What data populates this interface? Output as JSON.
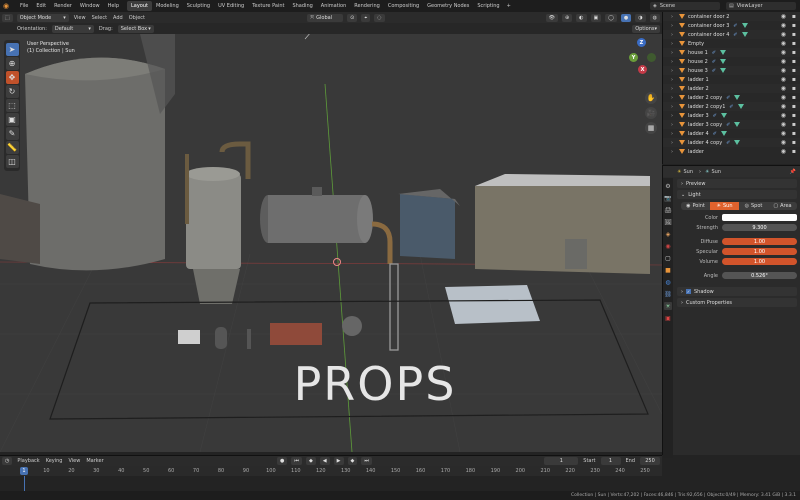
{
  "menubar": {
    "menus": [
      "File",
      "Edit",
      "Render",
      "Window",
      "Help"
    ],
    "workspaces": [
      "Layout",
      "Modeling",
      "Sculpting",
      "UV Editing",
      "Texture Paint",
      "Shading",
      "Animation",
      "Rendering",
      "Compositing",
      "Geometry Nodes",
      "Scripting"
    ],
    "active_workspace": "Layout",
    "add_tab": "+",
    "scene": "Scene",
    "view_layer": "ViewLayer"
  },
  "viewport_header": {
    "mode": "Object Mode",
    "menus": [
      "View",
      "Select",
      "Add",
      "Object"
    ],
    "transform": "Global"
  },
  "tool_header": {
    "orientation_label": "Orientation:",
    "orientation_value": "Default",
    "drag_label": "Drag:",
    "drag_value": "Select Box",
    "options": "Options"
  },
  "viewport": {
    "perspective": "User Perspective",
    "collection": "(1) Collection | Sun",
    "props_text": "PROPS"
  },
  "gizmo": {
    "z": "Z",
    "y": "Y",
    "x": "X"
  },
  "outliner": {
    "rows": [
      {
        "name": "container door 2",
        "mesh": false
      },
      {
        "name": "container door 3",
        "mesh": true
      },
      {
        "name": "container door 4",
        "mesh": true
      },
      {
        "name": "Empty",
        "mesh": false
      },
      {
        "name": "house 1",
        "mesh": true
      },
      {
        "name": "house 2",
        "mesh": true
      },
      {
        "name": "house 3",
        "mesh": true
      },
      {
        "name": "ladder 1",
        "mesh": false
      },
      {
        "name": "ladder 2",
        "mesh": false
      },
      {
        "name": "ladder 2 copy",
        "mesh": true
      },
      {
        "name": "ladder 2 copy1",
        "mesh": true
      },
      {
        "name": "ladder 3",
        "mesh": true
      },
      {
        "name": "ladder 3 copy",
        "mesh": true
      },
      {
        "name": "ladder 4",
        "mesh": true
      },
      {
        "name": "ladder 4 copy",
        "mesh": true
      },
      {
        "name": "ladder",
        "mesh": false
      }
    ]
  },
  "properties": {
    "object_name": "Sun",
    "data_name": "Sun",
    "panels": {
      "preview": "Preview",
      "light": "Light",
      "shadow": "Shadow",
      "custom": "Custom Properties"
    },
    "light_types": [
      "Point",
      "Sun",
      "Spot",
      "Area"
    ],
    "selected_light": "Sun",
    "color_label": "Color",
    "strength_label": "Strength",
    "strength": "9.300",
    "diffuse_label": "Diffuse",
    "diffuse": "1.00",
    "specular_label": "Specular",
    "specular": "1.00",
    "volume_label": "Volume",
    "volume": "1.00",
    "angle_label": "Angle",
    "angle": "0.526°"
  },
  "timeline": {
    "menus": [
      "Playback",
      "Keying",
      "View",
      "Marker"
    ],
    "current_frame": "1",
    "start_label": "Start",
    "start": "1",
    "end_label": "End",
    "end": "250",
    "ticks": [
      "1",
      "10",
      "20",
      "30",
      "40",
      "50",
      "60",
      "70",
      "80",
      "90",
      "100",
      "110",
      "120",
      "130",
      "140",
      "150",
      "160",
      "170",
      "180",
      "190",
      "200",
      "210",
      "220",
      "230",
      "240",
      "250"
    ],
    "playhead": "1"
  },
  "status": "Collection | Sun | Verts:47,202 | Faces:46,846 | Tris:92,656 | Objects:0/49 | Memory: 3.41 GiB | 3.3.1",
  "colors": {
    "accent": "#4772b3",
    "sun_selected": "#e0622d",
    "orange_field": "#d2542b"
  }
}
